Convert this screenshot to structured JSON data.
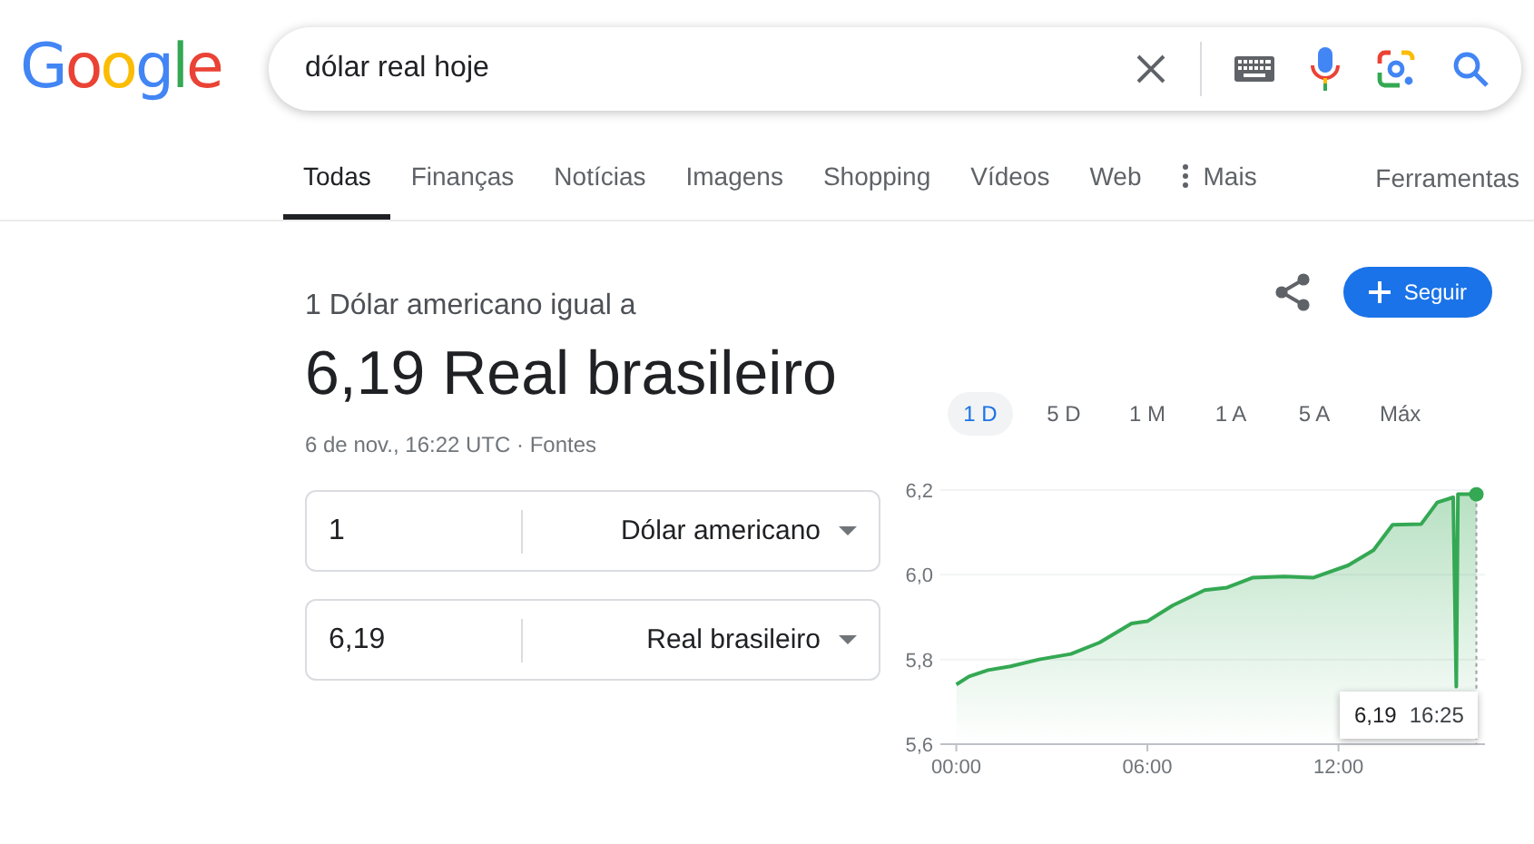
{
  "logo": "Google",
  "search": {
    "value": "dólar real hoje"
  },
  "tabs": [
    {
      "label": "Todas",
      "selected": true
    },
    {
      "label": "Finanças",
      "selected": false
    },
    {
      "label": "Notícias",
      "selected": false
    },
    {
      "label": "Imagens",
      "selected": false
    },
    {
      "label": "Shopping",
      "selected": false
    },
    {
      "label": "Vídeos",
      "selected": false
    },
    {
      "label": "Web",
      "selected": false
    },
    {
      "label": "Mais",
      "selected": false,
      "kind": "more"
    }
  ],
  "tools": "Ferramentas",
  "result": {
    "subtitle": "1 Dólar americano igual a",
    "value": "6,19 Real brasileiro",
    "meta": "6 de nov., 16:22 UTC · ",
    "sources": "Fontes",
    "follow": "Seguir"
  },
  "converter": [
    {
      "amount": "1",
      "currency": "Dólar americano"
    },
    {
      "amount": "6,19",
      "currency": "Real brasileiro"
    }
  ],
  "ranges": [
    {
      "label": "1 D",
      "selected": true
    },
    {
      "label": "5 D",
      "selected": false
    },
    {
      "label": "1 M",
      "selected": false
    },
    {
      "label": "1 A",
      "selected": false
    },
    {
      "label": "5 A",
      "selected": false
    },
    {
      "label": "Máx",
      "selected": false
    }
  ],
  "tooltip": {
    "value": "6,19",
    "time": "16:25"
  },
  "chart_data": {
    "type": "area",
    "xlim": [
      -0.5,
      16.6
    ],
    "ylim": [
      5.6,
      6.2
    ],
    "ref_lines": [
      {
        "axis": "x",
        "value": 16.33
      }
    ],
    "xticks": [
      {
        "value": 0,
        "label": "00:00"
      },
      {
        "value": 6,
        "label": "06:00"
      },
      {
        "value": 12,
        "label": "12:00"
      }
    ],
    "yticks": [
      {
        "value": 5.6,
        "label": "5,6"
      },
      {
        "value": 5.8,
        "label": "5,8"
      },
      {
        "value": 6.0,
        "label": "6,0"
      },
      {
        "value": 6.2,
        "label": "6,2"
      }
    ],
    "x": [
      0,
      0.4,
      1.0,
      1.7,
      2.6,
      3.6,
      4.5,
      5.5,
      6.0,
      6.8,
      7.8,
      8.5,
      9.3,
      10.3,
      11.2,
      12.3,
      13.1,
      13.7,
      14.6,
      15.1,
      15.6,
      15.7,
      15.75,
      16.33
    ],
    "series": [
      {
        "color": "#34a853",
        "values": [
          5.741,
          5.76,
          5.775,
          5.784,
          5.8,
          5.813,
          5.84,
          5.885,
          5.89,
          5.928,
          5.964,
          5.97,
          5.993,
          5.996,
          5.993,
          6.022,
          6.058,
          6.118,
          6.12,
          6.171,
          6.183,
          5.736,
          6.19,
          6.19
        ]
      }
    ]
  }
}
